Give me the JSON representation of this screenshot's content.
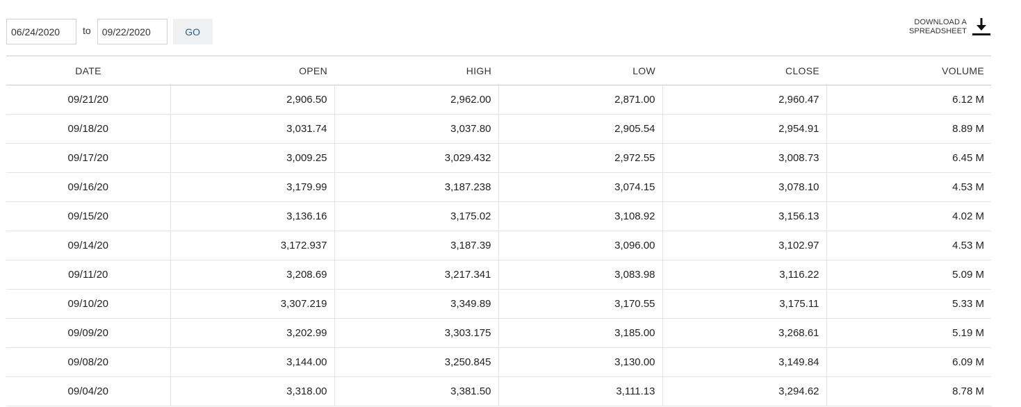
{
  "date_range": {
    "from_value": "06/24/2020",
    "to_label": "to",
    "to_value": "09/22/2020",
    "go_label": "GO"
  },
  "download": {
    "line1": "DOWNLOAD A",
    "line2": "SPREADSHEET",
    "icon": "download-icon"
  },
  "table": {
    "columns": [
      "DATE",
      "OPEN",
      "HIGH",
      "LOW",
      "CLOSE",
      "VOLUME"
    ],
    "rows": [
      [
        "09/21/20",
        "2,906.50",
        "2,962.00",
        "2,871.00",
        "2,960.47",
        "6.12 M"
      ],
      [
        "09/18/20",
        "3,031.74",
        "3,037.80",
        "2,905.54",
        "2,954.91",
        "8.89 M"
      ],
      [
        "09/17/20",
        "3,009.25",
        "3,029.432",
        "2,972.55",
        "3,008.73",
        "6.45 M"
      ],
      [
        "09/16/20",
        "3,179.99",
        "3,187.238",
        "3,074.15",
        "3,078.10",
        "4.53 M"
      ],
      [
        "09/15/20",
        "3,136.16",
        "3,175.02",
        "3,108.92",
        "3,156.13",
        "4.02 M"
      ],
      [
        "09/14/20",
        "3,172.937",
        "3,187.39",
        "3,096.00",
        "3,102.97",
        "4.53 M"
      ],
      [
        "09/11/20",
        "3,208.69",
        "3,217.341",
        "3,083.98",
        "3,116.22",
        "5.09 M"
      ],
      [
        "09/10/20",
        "3,307.219",
        "3,349.89",
        "3,170.55",
        "3,175.11",
        "5.33 M"
      ],
      [
        "09/09/20",
        "3,202.99",
        "3,303.175",
        "3,185.00",
        "3,268.61",
        "5.19 M"
      ],
      [
        "09/08/20",
        "3,144.00",
        "3,250.845",
        "3,130.00",
        "3,149.84",
        "6.09 M"
      ],
      [
        "09/04/20",
        "3,318.00",
        "3,381.50",
        "3,111.13",
        "3,294.62",
        "8.78 M"
      ]
    ]
  }
}
